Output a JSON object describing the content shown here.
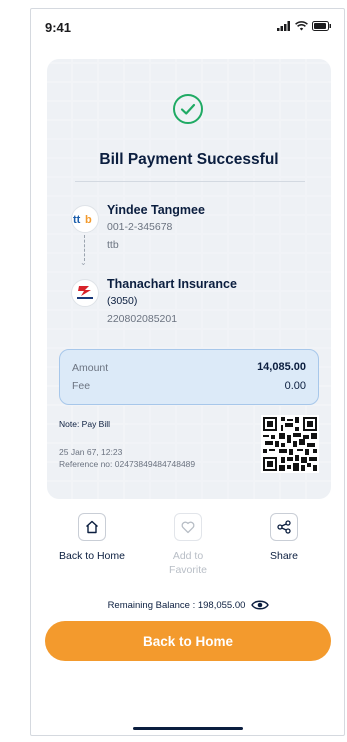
{
  "status_bar": {
    "time": "9:41"
  },
  "receipt": {
    "title": "Bill Payment Successful",
    "from": {
      "logo_text": "ttb",
      "name": "Yindee Tangmee",
      "account": "001-2-345678",
      "bank": "ttb"
    },
    "to": {
      "logo_text": "ธนชาต ประกันภัย",
      "name": "Thanachart Insurance",
      "code": "(3050)",
      "reference": "220802085201"
    },
    "amount_label": "Amount",
    "amount_value": "14,085.00",
    "fee_label": "Fee",
    "fee_value": "0.00",
    "note": "Note: Pay Bill",
    "datetime": "25 Jan 67, 12:23",
    "reference_line": "Reference no: 02473849484748489"
  },
  "actions": {
    "home_label": "Back to Home",
    "favorite_label_1": "Add to",
    "favorite_label_2": "Favorite",
    "share_label": "Share"
  },
  "balance": {
    "text": "Remaining Balance : 198,055.00"
  },
  "cta": {
    "label": "Back to Home"
  },
  "colors": {
    "primary": "#f39a2d",
    "success": "#1faa64",
    "navy": "#0b1e3f",
    "ttb_blue": "#1a5dab",
    "ttb_orange": "#f39a2d"
  },
  "icons": {
    "success": "check-circle-icon",
    "home": "home-icon",
    "favorite": "heart-icon",
    "share": "share-icon",
    "visibility": "eye-icon"
  }
}
